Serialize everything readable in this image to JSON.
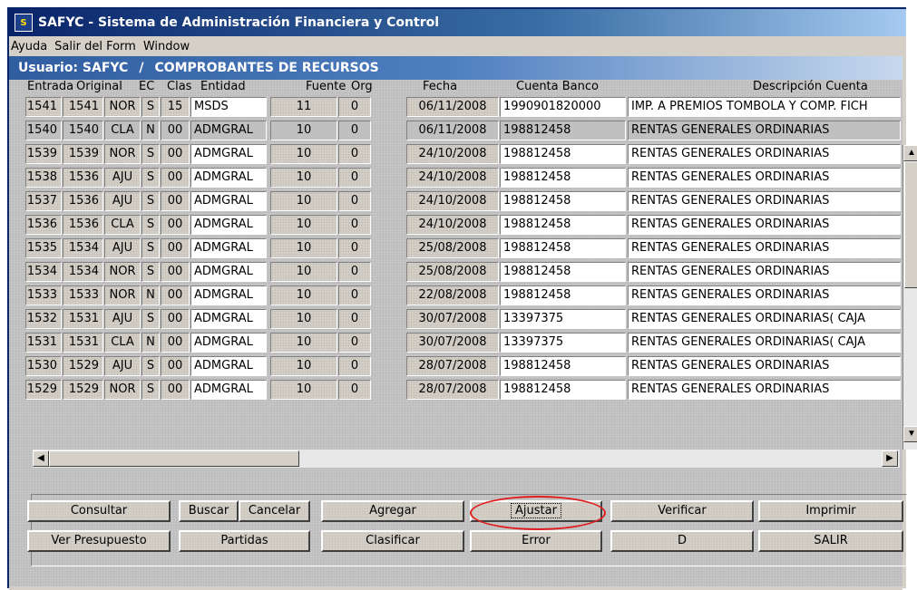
{
  "window": {
    "title": "SAFYC - Sistema de Administración Financiera y Control",
    "icon": "app-logo-icon"
  },
  "menu": [
    "Ayuda",
    "Salir del Form",
    "Window"
  ],
  "userbar": {
    "user": "Usuario: SAFYC",
    "separator": "/",
    "form_title": "COMPROBANTES DE RECURSOS"
  },
  "columns": [
    "Entrada",
    "Original",
    "EC",
    "Clas",
    "Entidad",
    "Fuente",
    "Org",
    "Fecha",
    "Cuenta Banco",
    "Descripción Cuenta"
  ],
  "rows": [
    [
      "1541",
      "1541",
      "NOR",
      "S",
      "15",
      "MSDS",
      "11",
      "0",
      "06/11/2008",
      "1990901820000",
      "IMP. A PREMIOS TOMBOLA Y COMP. FICH"
    ],
    [
      "1540",
      "1540",
      "CLA",
      "N",
      "00",
      "ADMGRAL",
      "10",
      "0",
      "06/11/2008",
      "198812458",
      "RENTAS GENERALES ORDINARIAS"
    ],
    [
      "1539",
      "1539",
      "NOR",
      "S",
      "00",
      "ADMGRAL",
      "10",
      "0",
      "24/10/2008",
      "198812458",
      "RENTAS GENERALES ORDINARIAS"
    ],
    [
      "1538",
      "1536",
      "AJU",
      "S",
      "00",
      "ADMGRAL",
      "10",
      "0",
      "24/10/2008",
      "198812458",
      "RENTAS GENERALES ORDINARIAS"
    ],
    [
      "1537",
      "1536",
      "AJU",
      "S",
      "00",
      "ADMGRAL",
      "10",
      "0",
      "24/10/2008",
      "198812458",
      "RENTAS GENERALES ORDINARIAS"
    ],
    [
      "1536",
      "1536",
      "CLA",
      "S",
      "00",
      "ADMGRAL",
      "10",
      "0",
      "24/10/2008",
      "198812458",
      "RENTAS GENERALES ORDINARIAS"
    ],
    [
      "1535",
      "1534",
      "AJU",
      "S",
      "00",
      "ADMGRAL",
      "10",
      "0",
      "25/08/2008",
      "198812458",
      "RENTAS GENERALES ORDINARIAS"
    ],
    [
      "1534",
      "1534",
      "NOR",
      "S",
      "00",
      "ADMGRAL",
      "10",
      "0",
      "25/08/2008",
      "198812458",
      "RENTAS GENERALES ORDINARIAS"
    ],
    [
      "1533",
      "1533",
      "NOR",
      "N",
      "00",
      "ADMGRAL",
      "10",
      "0",
      "22/08/2008",
      "198812458",
      "RENTAS GENERALES ORDINARIAS"
    ],
    [
      "1532",
      "1531",
      "AJU",
      "S",
      "00",
      "ADMGRAL",
      "10",
      "0",
      "30/07/2008",
      "13397375",
      "RENTAS GENERALES ORDINARIAS( CAJA"
    ],
    [
      "1531",
      "1531",
      "CLA",
      "N",
      "00",
      "ADMGRAL",
      "10",
      "0",
      "30/07/2008",
      "13397375",
      "RENTAS GENERALES ORDINARIAS( CAJA"
    ],
    [
      "1530",
      "1529",
      "AJU",
      "S",
      "00",
      "ADMGRAL",
      "10",
      "0",
      "28/07/2008",
      "198812458",
      "RENTAS GENERALES ORDINARIAS"
    ],
    [
      "1529",
      "1529",
      "NOR",
      "S",
      "00",
      "ADMGRAL",
      "10",
      "0",
      "28/07/2008",
      "198812458",
      "RENTAS GENERALES ORDINARIAS"
    ]
  ],
  "selected_row": 1,
  "buttons_row1": {
    "consultar": "Consultar",
    "buscar": "Buscar",
    "cancelar": "Cancelar",
    "agregar": "Agregar",
    "ajustar": "Ajustar",
    "verificar": "Verificar",
    "imprimir": "Imprimir"
  },
  "buttons_row2": {
    "ver_presupuesto": "Ver Presupuesto",
    "partidas": "Partidas",
    "clasificar": "Clasificar",
    "error": "Error",
    "d": "D",
    "salir": "SALIR"
  },
  "highlight_color": "#e02020",
  "titlebar_color": "#0a246a"
}
